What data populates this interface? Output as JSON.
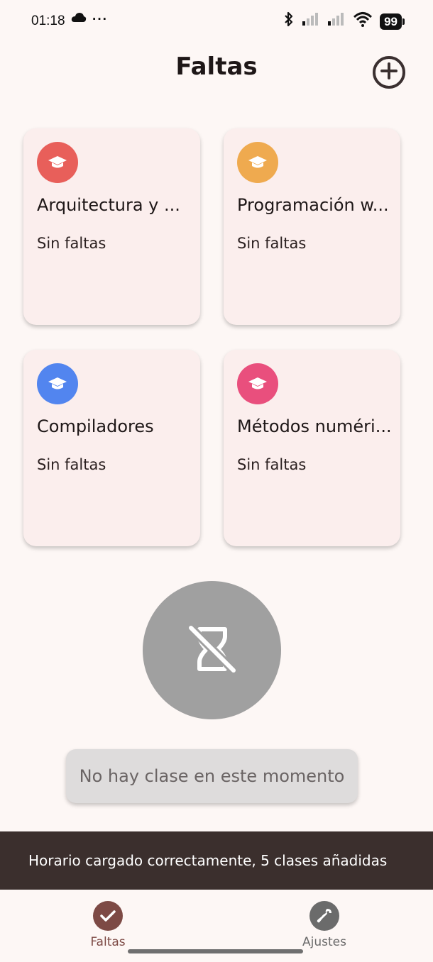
{
  "status_bar": {
    "time": "01:18",
    "cloud_icon": "cloud-icon",
    "more": "···",
    "battery": "99"
  },
  "header": {
    "title": "Faltas",
    "add_icon": "plus-circle-icon"
  },
  "subjects": [
    {
      "name": "Arquitectura y ...",
      "status": "Sin faltas",
      "color": "#e85f5a",
      "icon": "graduation-cap-icon"
    },
    {
      "name": "Programación w...",
      "status": "Sin faltas",
      "color": "#efaa4f",
      "icon": "graduation-cap-icon"
    },
    {
      "name": "Compiladores",
      "status": "Sin faltas",
      "color": "#5285ef",
      "icon": "graduation-cap-icon"
    },
    {
      "name": "Métodos numéri...",
      "status": "Sin faltas",
      "color": "#e94f7d",
      "icon": "graduation-cap-icon"
    }
  ],
  "current_class": {
    "icon": "hourglass-disabled-icon",
    "message": "No hay clase en este momento"
  },
  "snackbar": {
    "message": "Horario cargado correctamente, 5 clases añadidas"
  },
  "bottom_nav": {
    "items": [
      {
        "label": "Faltas",
        "icon": "check-icon",
        "active": true,
        "color": "#7d4a45"
      },
      {
        "label": "Ajustes",
        "icon": "wrench-icon",
        "active": false,
        "color": "#6b6b6b"
      }
    ]
  }
}
